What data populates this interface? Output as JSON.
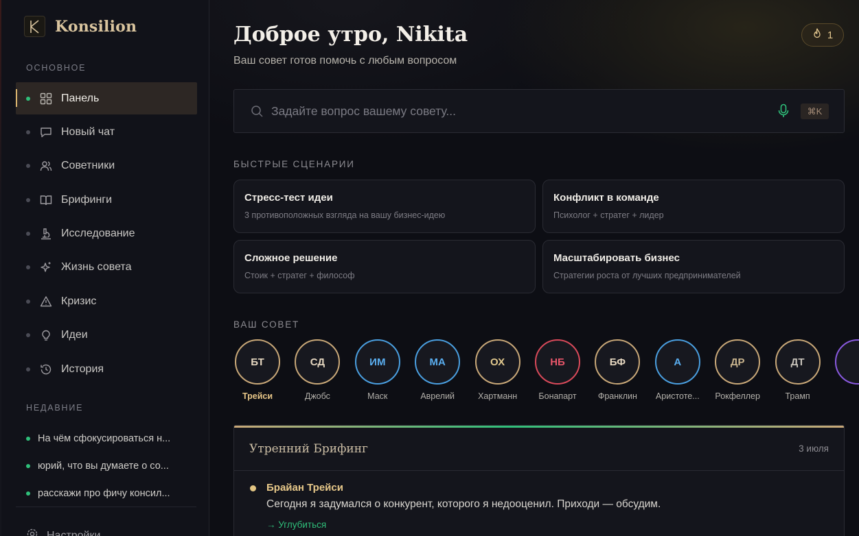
{
  "app": {
    "name": "Konsilion",
    "logo_letter": "K"
  },
  "sidebar": {
    "section_main": "ОСНОВНОЕ",
    "items": [
      {
        "label": "Панель",
        "icon": "dashboard-grid-icon",
        "active": true
      },
      {
        "label": "Новый чат",
        "icon": "chat-bubble-icon"
      },
      {
        "label": "Советники",
        "icon": "users-icon"
      },
      {
        "label": "Брифинги",
        "icon": "book-open-icon"
      },
      {
        "label": "Исследование",
        "icon": "microscope-icon"
      },
      {
        "label": "Жизнь совета",
        "icon": "sparkles-icon"
      },
      {
        "label": "Кризис",
        "icon": "warning-triangle-icon"
      },
      {
        "label": "Идеи",
        "icon": "lightbulb-icon"
      },
      {
        "label": "История",
        "icon": "history-icon"
      }
    ],
    "section_recent": "НЕДАВНИЕ",
    "recent": [
      "На чём сфокусироваться н...",
      "юрий, что вы думаете о со...",
      "расскажи про фичу консил..."
    ],
    "settings_label": "Настройки"
  },
  "header": {
    "greeting": "Доброе утро, Nikita",
    "subtitle": "Ваш совет готов помочь с любым вопросом",
    "streak_count": "1"
  },
  "search": {
    "placeholder": "Задайте вопрос вашему совету...",
    "value": "",
    "shortcut": "⌘K"
  },
  "scenarios": {
    "label": "БЫСТРЫЕ СЦЕНАРИИ",
    "cards": [
      {
        "title": "Стресс-тест идеи",
        "desc": "3 противоположных взгляда на вашу бизнес-идею"
      },
      {
        "title": "Конфликт в команде",
        "desc": "Психолог + стратег + лидер"
      },
      {
        "title": "Сложное решение",
        "desc": "Стоик + стратег + философ"
      },
      {
        "title": "Масштабировать бизнес",
        "desc": "Стратегии роста от лучших предпринимателей"
      }
    ]
  },
  "council": {
    "label": "ВАШ СОВЕТ",
    "advisors": [
      {
        "initials": "БТ",
        "name": "Трейси",
        "ring": "#c9a878",
        "text": "#e6d7c0",
        "selected": true
      },
      {
        "initials": "СД",
        "name": "Джобс",
        "ring": "#c9a878",
        "text": "#e6d7c0"
      },
      {
        "initials": "ИМ",
        "name": "Маск",
        "ring": "#4a9fe0",
        "text": "#5aaef0"
      },
      {
        "initials": "МА",
        "name": "Аврелий",
        "ring": "#4a9fe0",
        "text": "#5aaef0"
      },
      {
        "initials": "ОХ",
        "name": "Хартманн",
        "ring": "#c9a878",
        "text": "#e2c98e"
      },
      {
        "initials": "НБ",
        "name": "Бонапарт",
        "ring": "#d94a5a",
        "text": "#e8566a"
      },
      {
        "initials": "БФ",
        "name": "Франклин",
        "ring": "#c9a878",
        "text": "#e6d7c0"
      },
      {
        "initials": "А",
        "name": "Аристоте...",
        "ring": "#4a9fe0",
        "text": "#5aaef0"
      },
      {
        "initials": "ДР",
        "name": "Рокфеллер",
        "ring": "#c9a878",
        "text": "#c9b48e"
      },
      {
        "initials": "ДТ",
        "name": "Трамп",
        "ring": "#c9a878",
        "text": "#c9c4bb"
      },
      {
        "initials": "",
        "name": "",
        "ring": "#8a5ae0",
        "text": "#8a5ae0"
      }
    ]
  },
  "briefing": {
    "title": "Утренний Брифинг",
    "date": "3 июля",
    "author": "Брайан Трейси",
    "text": "Сегодня я задумался о конкурент, которого я недооценил. Приходи — обсудим.",
    "link": "→ Углубиться"
  },
  "colors": {
    "accent_gold": "#d9b36e",
    "accent_green": "#2fbf7a",
    "background": "#0d0e14"
  }
}
